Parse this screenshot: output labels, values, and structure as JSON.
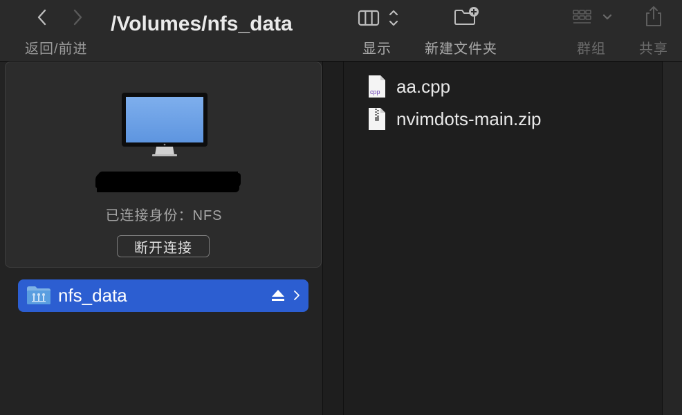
{
  "toolbar": {
    "nav_label": "返回/前进",
    "path_title": "/Volumes/nfs_data",
    "view_label": "显示",
    "new_folder_label": "新建文件夹",
    "group_label": "群组",
    "share_label": "共享"
  },
  "sidebar": {
    "connection_status": "已连接身份：NFS",
    "disconnect_label": "断开连接",
    "volume": {
      "name": "nfs_data"
    }
  },
  "files": [
    {
      "name": "aa.cpp",
      "type": "cpp",
      "icon_label": "cpp"
    },
    {
      "name": "nvimdots-main.zip",
      "type": "zip"
    }
  ],
  "colors": {
    "accent": "#2c5ed1",
    "background": "#1e1e1e",
    "toolbar": "#2a2a2a"
  }
}
